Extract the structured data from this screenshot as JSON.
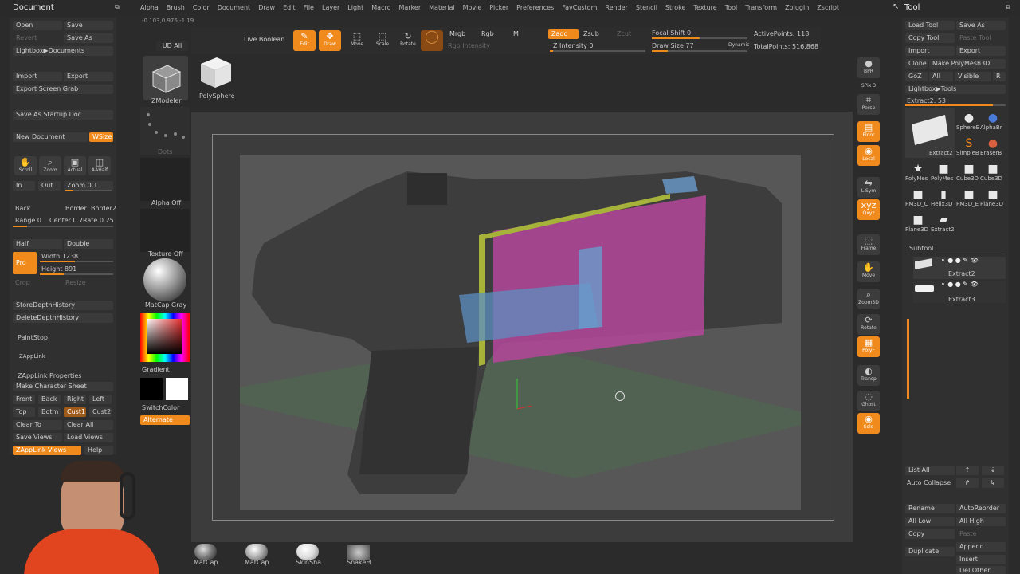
{
  "topbar": {
    "doc_title": "Document",
    "menus": [
      "Alpha",
      "Brush",
      "Color",
      "Document",
      "Draw",
      "Edit",
      "File",
      "Layer",
      "Light",
      "Macro",
      "Marker",
      "Material",
      "Movie",
      "Picker",
      "Preferences",
      "FavCustom",
      "Render",
      "Stencil",
      "Stroke",
      "Texture",
      "Tool",
      "Transform",
      "Zplugin",
      "Zscript"
    ],
    "coords": "-0.103,0.976,-1.19",
    "tool_title": "Tool"
  },
  "left": {
    "open": "Open",
    "save": "Save",
    "revert": "Revert",
    "save_as": "Save As",
    "lightbox_docs": "Lightbox▶Documents",
    "import": "Import",
    "export": "Export",
    "screen_grab": "Export Screen Grab",
    "startup": "Save As Startup Doc",
    "new_doc": "New Document",
    "wsize": "WSize",
    "nav": [
      "Scroll",
      "Zoom",
      "Actual",
      "AAHalf"
    ],
    "in": "In",
    "out": "Out",
    "zoom": "Zoom 0.1",
    "back": "Back",
    "border": "Border",
    "border2": "Border2",
    "range": "Range 0",
    "center": "Center 0.7",
    "rate": "Rate 0.25",
    "half": "Half",
    "double": "Double",
    "pro": "Pro",
    "width": "Width 1238",
    "height": "Height 891",
    "crop": "Crop",
    "resize": "Resize",
    "store_depth": "StoreDepthHistory",
    "delete_depth": "DeleteDepthHistory",
    "paintstop": "PaintStop",
    "zapplink": "ZAppLink",
    "zapplink_props": "ZAppLink Properties",
    "char_sheet": "Make Character Sheet",
    "front": "Front",
    "back2": "Back",
    "right": "Right",
    "left2": "Left",
    "top": "Top",
    "bottom": "Botm",
    "cust1": "Cust1",
    "cust2": "Cust2",
    "clear_to": "Clear To",
    "clear_all": "Clear All",
    "save_views": "Save Views",
    "load_views": "Load Views",
    "zapplink_views": "ZAppLink Views",
    "help": "Help"
  },
  "shelf": {
    "ud_all": "UD All",
    "zmodeler": "ZModeler",
    "polysphere": "PolySphere",
    "dots": "Dots",
    "alpha_off": "Alpha Off",
    "texture_off": "Texture Off",
    "matcap_gray": "MatCap Gray",
    "gradient": "Gradient",
    "switch_color": "SwitchColor",
    "alternate": "Alternate"
  },
  "toolbar": {
    "live_boolean": "Live Boolean",
    "edit": "Edit",
    "draw": "Draw",
    "move": "Move",
    "scale": "Scale",
    "rotate": "Rotate",
    "mrgb": "Mrgb",
    "rgb": "Rgb",
    "m": "M",
    "rgb_intensity": "Rgb Intensity",
    "zadd": "Zadd",
    "zsub": "Zsub",
    "zcut": "Zcut",
    "z_intensity": "Z Intensity 0",
    "focal_shift": "Focal Shift 0",
    "draw_size": "Draw Size 77",
    "dynamic": "Dynamic",
    "active_points": "ActivePoints: 118",
    "total_points": "TotalPoints: 516,868"
  },
  "rightbar": [
    "BPR",
    "SPix 3",
    "Persp",
    "Floor",
    "Local",
    "L.Sym",
    "Qxyz",
    "Frame",
    "Move",
    "Zoom3D",
    "Rotate",
    "PolyF",
    "Transp",
    "Ghost",
    "Solo"
  ],
  "tool": {
    "load_tool": "Load Tool",
    "save_as": "Save As",
    "copy_tool": "Copy Tool",
    "paste_tool": "Paste Tool",
    "import": "Import",
    "export": "Export",
    "clone": "Clone",
    "make_polymesh": "Make PolyMesh3D",
    "goz": "GoZ",
    "all": "All",
    "visible": "Visible",
    "r": "R",
    "lightbox_tools": "Lightbox▶Tools",
    "extract_slider": "Extract2. 53",
    "thumbs": [
      "Extract2",
      "SphereE",
      "AlphaBr",
      "SimpleB",
      "EraserB",
      "PolyMes",
      "PolyMes",
      "Cube3D",
      "Cube3D",
      "PM3D_C",
      "Helix3D",
      "PM3D_E",
      "Plane3D",
      "Plane3D",
      "Extract2"
    ],
    "subtool_title": "Subtool",
    "subtools": [
      "Extract2",
      "Extract3"
    ],
    "list_all": "List All",
    "auto_collapse": "Auto Collapse",
    "rename": "Rename",
    "auto_reorder": "AutoReorder",
    "all_low": "All Low",
    "all_high": "All High",
    "copy": "Copy",
    "paste": "Paste",
    "duplicate": "Duplicate",
    "append": "Append",
    "insert": "Insert",
    "del_other": "Del Other"
  },
  "materials": [
    "MatCap",
    "MatCap",
    "SkinSha",
    "SnakeH"
  ],
  "colors": {
    "accent": "#f08a1c",
    "panel": "#333333",
    "canvas": "#555555",
    "magenta": "#b4469a",
    "blue": "#5c8fc0",
    "yellow": "#a6b23a"
  }
}
